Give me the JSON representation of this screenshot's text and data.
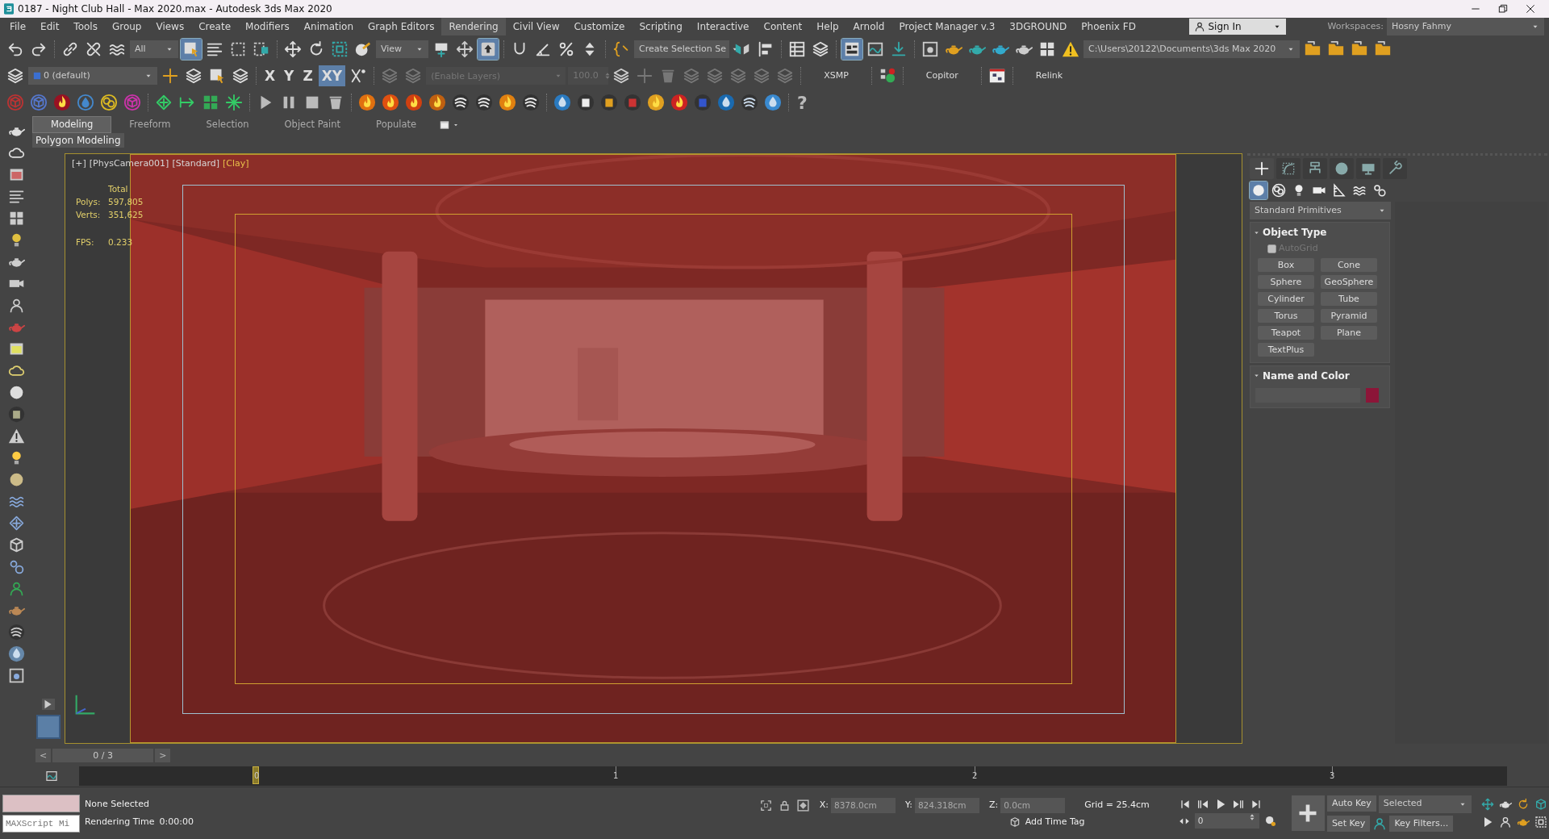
{
  "window": {
    "title": "0187 - Night Club Hall - Max 2020.max - Autodesk 3ds Max 2020"
  },
  "menu": [
    {
      "label": "File",
      "selected": false
    },
    {
      "label": "Edit",
      "selected": false
    },
    {
      "label": "Tools",
      "selected": false
    },
    {
      "label": "Group",
      "selected": false
    },
    {
      "label": "Views",
      "selected": false
    },
    {
      "label": "Create",
      "selected": false
    },
    {
      "label": "Modifiers",
      "selected": false
    },
    {
      "label": "Animation",
      "selected": false
    },
    {
      "label": "Graph Editors",
      "selected": false
    },
    {
      "label": "Rendering",
      "selected": true
    },
    {
      "label": "Civil View",
      "selected": false
    },
    {
      "label": "Customize",
      "selected": false
    },
    {
      "label": "Scripting",
      "selected": false
    },
    {
      "label": "Interactive",
      "selected": false
    },
    {
      "label": "Content",
      "selected": false
    },
    {
      "label": "Help",
      "selected": false
    },
    {
      "label": "Arnold",
      "selected": false
    },
    {
      "label": "Project Manager v.3",
      "selected": false
    },
    {
      "label": "3DGROUND",
      "selected": false
    },
    {
      "label": "Phoenix FD",
      "selected": false
    }
  ],
  "sign_in": "Sign In",
  "workspaces": {
    "label": "Workspaces:",
    "value": "Hosny Fahmy"
  },
  "main_toolbar": {
    "selection_filter": "All",
    "reference_coordinate": "View",
    "named_selection": "Create Selection Se",
    "project_folder": "C:\\Users\\20122\\Documents\\3ds Max 2020"
  },
  "layer_toolbar": {
    "layer": "0 (default)",
    "axes": [
      {
        "label": "X",
        "selected": false
      },
      {
        "label": "Y",
        "selected": false
      },
      {
        "label": "Z",
        "selected": false
      },
      {
        "label": "XY",
        "selected": true
      }
    ],
    "layer_field": {
      "placeholder": "(Enable Layers)"
    },
    "amount": "100.0",
    "scripts": [
      "XSMP",
      "Copitor",
      "Relink"
    ]
  },
  "help_button": "?",
  "ribbon": {
    "tabs": [
      {
        "label": "Modeling",
        "selected": true
      },
      {
        "label": "Freeform",
        "selected": false
      },
      {
        "label": "Selection",
        "selected": false
      },
      {
        "label": "Object Paint",
        "selected": false
      },
      {
        "label": "Populate",
        "selected": false
      }
    ],
    "panel": "Polygon Modeling"
  },
  "viewport": {
    "labels": [
      {
        "text": "[+]",
        "highlighted": false
      },
      {
        "text": "[PhysCamera001]",
        "highlighted": false
      },
      {
        "text": "[Standard]",
        "highlighted": false
      },
      {
        "text": "[Clay]",
        "highlighted": true
      }
    ],
    "stats_header": "Total",
    "stats": [
      {
        "label": "Polys:",
        "value": "597,805"
      },
      {
        "label": "Verts:",
        "value": "351,625"
      },
      {
        "label": "FPS:",
        "value": "0.233"
      }
    ]
  },
  "command_panel": {
    "tabs": [
      {
        "kind": "create",
        "selected": true
      },
      {
        "kind": "modify",
        "selected": false
      },
      {
        "kind": "hierarchy",
        "selected": false
      },
      {
        "kind": "motion",
        "selected": false
      },
      {
        "kind": "display",
        "selected": false
      },
      {
        "kind": "utilities",
        "selected": false
      }
    ],
    "categories": [
      {
        "kind": "geometry",
        "selected": true
      },
      {
        "kind": "shapes",
        "selected": false
      },
      {
        "kind": "lights",
        "selected": false
      },
      {
        "kind": "cameras",
        "selected": false
      },
      {
        "kind": "helpers",
        "selected": false
      },
      {
        "kind": "space_warps",
        "selected": false
      },
      {
        "kind": "systems",
        "selected": false
      }
    ],
    "dropdown": "Standard Primitives",
    "object_type": {
      "title": "Object Type",
      "autogrid": {
        "label": "AutoGrid",
        "checked": false,
        "disabled": true
      },
      "buttons": [
        "Box",
        "Cone",
        "Sphere",
        "GeoSphere",
        "Cylinder",
        "Tube",
        "Torus",
        "Pyramid",
        "Teapot",
        "Plane",
        "TextPlus"
      ]
    },
    "name_and_color": {
      "title": "Name and Color",
      "color": "#8c1538"
    }
  },
  "time_slider": {
    "prev": "<",
    "position": "0 / 3",
    "next": ">"
  },
  "track_bar": {
    "ticks": [
      "0",
      "1",
      "2",
      "3"
    ]
  },
  "status": {
    "maxscript": {
      "placeholder": "MAXScript Mi"
    },
    "selection": "None Selected",
    "render_time_label": "Rendering Time",
    "render_time": "0:00:00",
    "coords": [
      {
        "label": "X:",
        "value": "8378.0cm"
      },
      {
        "label": "Y:",
        "value": "824.318cm"
      },
      {
        "label": "Z:",
        "value": "0.0cm"
      }
    ],
    "grid": "Grid = 25.4cm",
    "time_tag": "Add Time Tag",
    "frame": "0",
    "auto_key": "Auto Key",
    "key_mode": "Selected",
    "set_key": "Set Key",
    "key_filters": "Key Filters..."
  }
}
